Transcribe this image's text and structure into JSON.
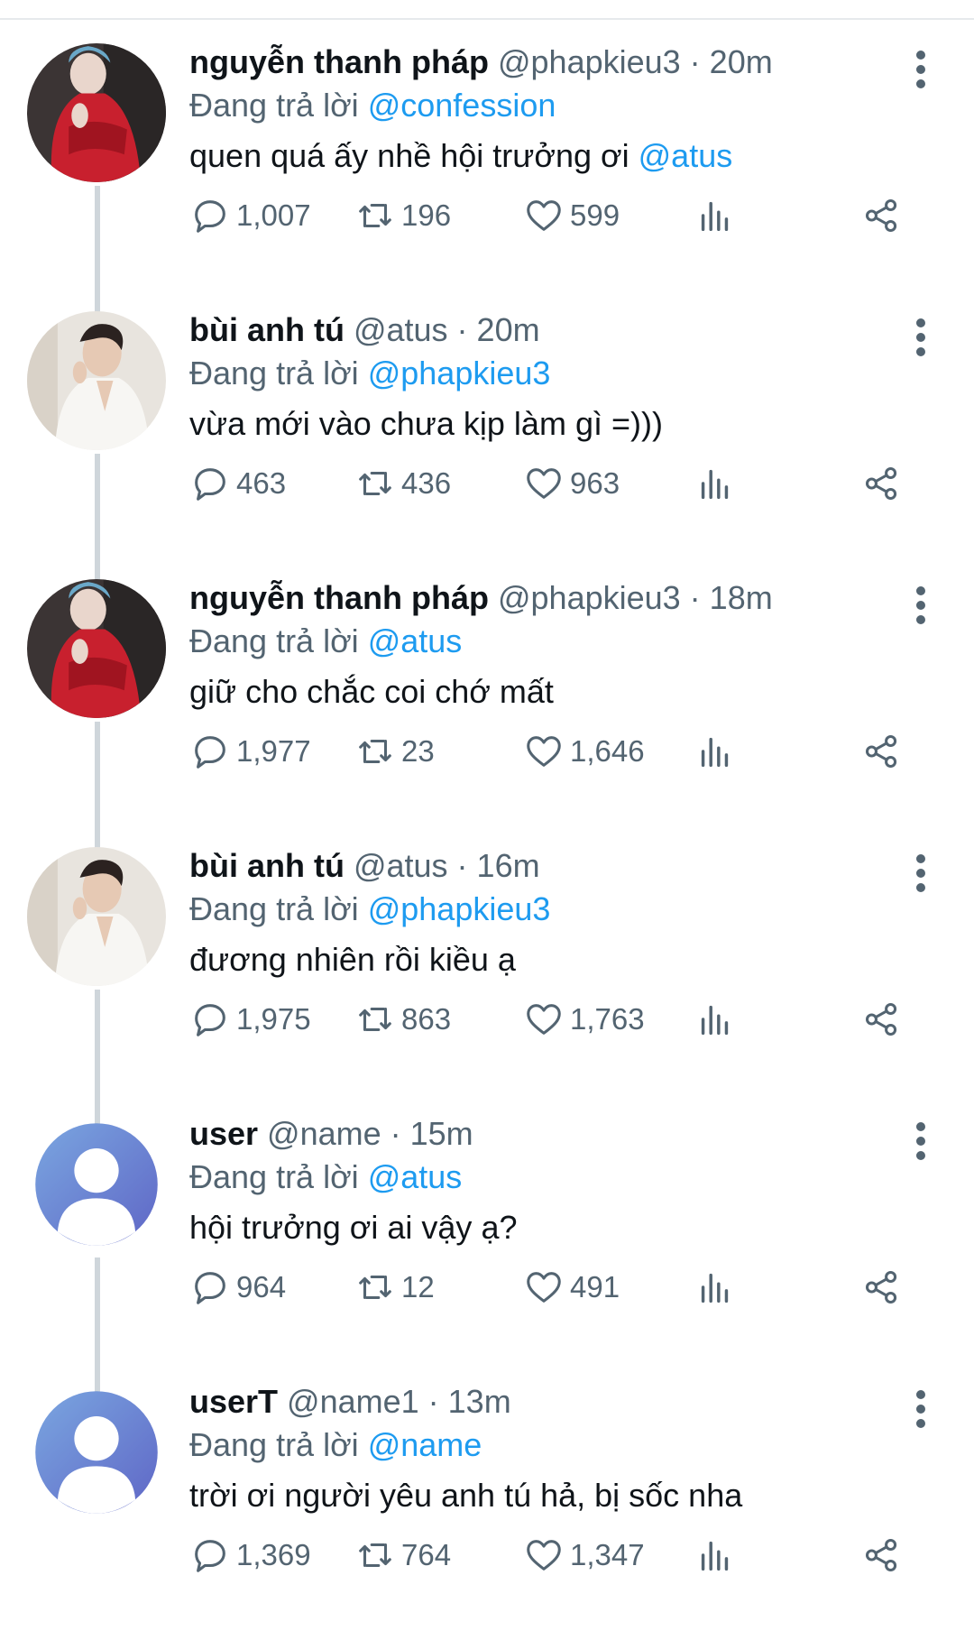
{
  "tweets": [
    {
      "name": "nguyễn thanh pháp",
      "handle": "@phapkieu3 · 20m",
      "replying_label": "Đang trả lời",
      "replying_to": "@confession",
      "text_before": "quen quá ấy nhề hội trưởng ơi ",
      "text_mention": "@atus",
      "replies": "1,007",
      "retweets": "196",
      "likes": "599",
      "avatar": "red-dress-photo"
    },
    {
      "name": "bùi anh tú",
      "handle": "@atus · 20m",
      "replying_label": "Đang trả lời",
      "replying_to": "@phapkieu3",
      "text_before": "vừa mới vào chưa kịp làm gì =)))",
      "text_mention": "",
      "replies": "463",
      "retweets": "436",
      "likes": "963",
      "avatar": "white-shirt-photo"
    },
    {
      "name": "nguyễn thanh pháp",
      "handle": "@phapkieu3 · 18m",
      "replying_label": "Đang trả lời",
      "replying_to": "@atus",
      "text_before": "giữ cho chắc coi chớ mất",
      "text_mention": "",
      "replies": "1,977",
      "retweets": "23",
      "likes": "1,646",
      "avatar": "red-dress-photo"
    },
    {
      "name": "bùi anh tú",
      "handle": "@atus · 16m",
      "replying_label": "Đang trả lời",
      "replying_to": "@phapkieu3",
      "text_before": "đương nhiên rồi kiều ạ",
      "text_mention": "",
      "replies": "1,975",
      "retweets": "863",
      "likes": "1,763",
      "avatar": "white-shirt-photo"
    },
    {
      "name": "user",
      "handle": "@name · 15m",
      "replying_label": "Đang trả lời",
      "replying_to": "@atus",
      "text_before": "hội trưởng ơi ai vậy ạ?",
      "text_mention": "",
      "replies": "964",
      "retweets": "12",
      "likes": "491",
      "avatar": "default-user-icon"
    },
    {
      "name": "userT",
      "handle": "@name1 · 13m",
      "replying_label": "Đang trả lời",
      "replying_to": "@name",
      "text_before": "trời ơi người yêu anh tú hả, bị sốc nha",
      "text_mention": "",
      "replies": "1,369",
      "retweets": "764",
      "likes": "1,347",
      "avatar": "default-user-icon"
    }
  ],
  "colors": {
    "link": "#1d9bf0",
    "secondary_text": "#536471",
    "primary_text": "#0f1419",
    "thread_rail": "#cfd6db"
  }
}
